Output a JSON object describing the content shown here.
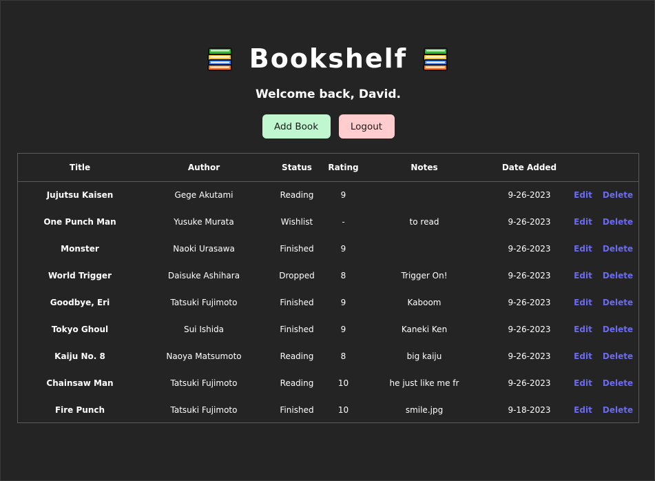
{
  "app": {
    "title": "Bookshelf",
    "welcome": "Welcome back, David.",
    "add_button_label": "Add Book",
    "logout_button_label": "Logout"
  },
  "table": {
    "headers": {
      "title": "Title",
      "author": "Author",
      "status": "Status",
      "rating": "Rating",
      "notes": "Notes",
      "date_added": "Date Added"
    },
    "edit_label": "Edit",
    "delete_label": "Delete",
    "rows": [
      {
        "title": "Jujutsu Kaisen",
        "author": "Gege Akutami",
        "status": "Reading",
        "rating": "9",
        "notes": "",
        "date": "9-26-2023"
      },
      {
        "title": "One Punch Man",
        "author": "Yusuke Murata",
        "status": "Wishlist",
        "rating": "-",
        "notes": "to read",
        "date": "9-26-2023"
      },
      {
        "title": "Monster",
        "author": "Naoki Urasawa",
        "status": "Finished",
        "rating": "9",
        "notes": "",
        "date": "9-26-2023"
      },
      {
        "title": "World Trigger",
        "author": "Daisuke Ashihara",
        "status": "Dropped",
        "rating": "8",
        "notes": "Trigger On!",
        "date": "9-26-2023"
      },
      {
        "title": "Goodbye, Eri",
        "author": "Tatsuki Fujimoto",
        "status": "Finished",
        "rating": "9",
        "notes": "Kaboom",
        "date": "9-26-2023"
      },
      {
        "title": "Tokyo Ghoul",
        "author": "Sui Ishida",
        "status": "Finished",
        "rating": "9",
        "notes": "Kaneki Ken",
        "date": "9-26-2023"
      },
      {
        "title": "Kaiju No. 8",
        "author": "Naoya Matsumoto",
        "status": "Reading",
        "rating": "8",
        "notes": "big kaiju",
        "date": "9-26-2023"
      },
      {
        "title": "Chainsaw Man",
        "author": "Tatsuki Fujimoto",
        "status": "Reading",
        "rating": "10",
        "notes": "he just like me fr",
        "date": "9-26-2023"
      },
      {
        "title": "Fire Punch",
        "author": "Tatsuki Fujimoto",
        "status": "Finished",
        "rating": "10",
        "notes": "smile.jpg",
        "date": "9-18-2023"
      }
    ]
  },
  "colors": {
    "background": "#242424",
    "add_button": "#c0f7d1",
    "logout_button": "#ffcdcd",
    "link": "#6b6bf0"
  },
  "icons": {
    "header_left": "books-icon",
    "header_right": "books-icon"
  }
}
